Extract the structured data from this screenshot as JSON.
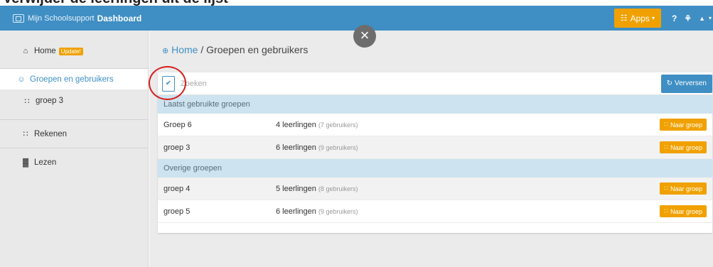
{
  "caption": {
    "partial_text": "Verwijder de leerlingen uit de lijst"
  },
  "navbar": {
    "brand_small": "Mijn Schoolsupport",
    "brand_strong": "Dashboard",
    "apps_label": "Apps",
    "help_icon": "?",
    "settings_icon": "⚘",
    "user_icon": "▲"
  },
  "overlay": {
    "close_label": "×"
  },
  "sidebar": {
    "items": [
      {
        "icon": "⌂",
        "label": "Home",
        "badge": "Update!"
      },
      {
        "icon": "☺",
        "label": "Groepen en gebruikers"
      },
      {
        "icon": "∷",
        "label": "groep 3"
      },
      {
        "icon": "∷",
        "label": "Rekenen"
      },
      {
        "icon": "▓",
        "label": "Lezen"
      }
    ]
  },
  "breadcrumb": {
    "home_icon": "⊕",
    "home": "Home",
    "separator": "/",
    "current": "Groepen en gebruikers"
  },
  "search": {
    "placeholder": "Zoeken",
    "refresh_icon": "↻",
    "refresh_label": "Verversen",
    "checkbox_icon": "✔"
  },
  "sections": [
    {
      "title": "Laatst gebruikte groepen",
      "rows": [
        {
          "name": "Groep 6",
          "students": "4 leerlingen",
          "users": "(7 gebruikers)",
          "button": "Naar groep"
        },
        {
          "name": "groep 3",
          "students": "6 leerlingen",
          "users": "(9 gebruikers)",
          "button": "Naar groep"
        }
      ]
    },
    {
      "title": "Overige groepen",
      "rows": [
        {
          "name": "groep 4",
          "students": "5 leerlingen",
          "users": "(8 gebruikers)",
          "button": "Naar groep"
        },
        {
          "name": "groep 5",
          "students": "6 leerlingen",
          "users": "(9 gebruikers)",
          "button": "Naar groep"
        }
      ]
    }
  ],
  "button_icon": "∷",
  "colors": {
    "primary": "#3f8fc4",
    "accent": "#f0a100",
    "annotation": "#d81e1e"
  }
}
